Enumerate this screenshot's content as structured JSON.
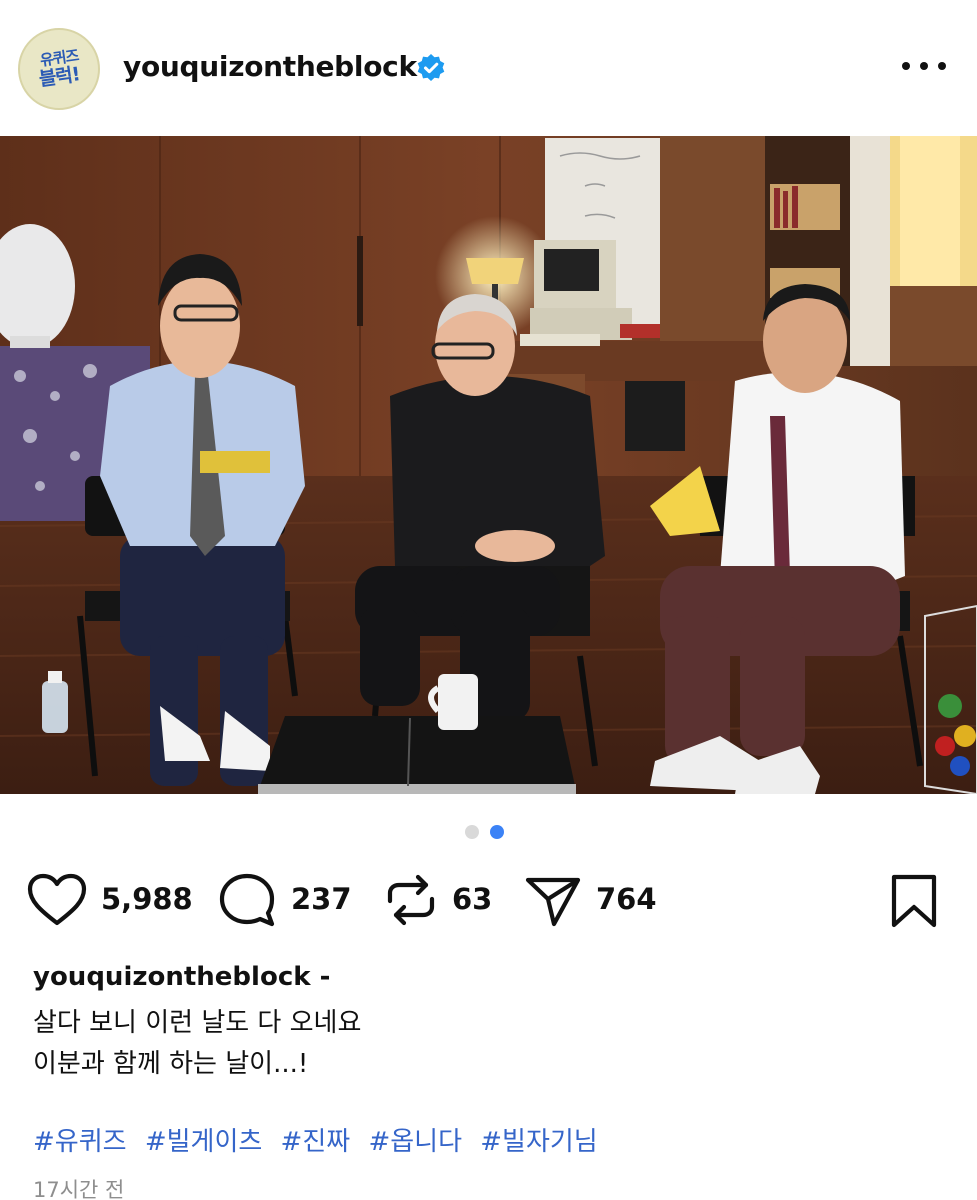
{
  "header": {
    "avatar_text_line1": "유퀴즈",
    "avatar_text_line2": "블럭!",
    "username": "youquizontheblock",
    "verified_icon": "verified-badge-icon",
    "more_icon": "more-horizontal-icon"
  },
  "carousel": {
    "total": 2,
    "active_index": 2
  },
  "actions": {
    "likes": "5,988",
    "comments": "237",
    "reposts": "63",
    "shares": "764"
  },
  "caption": {
    "username": "youquizontheblock",
    "separator": "-",
    "line1": "살다 보니 이런 날도 다 오네요",
    "line2": "이분과 함께 하는 날이...!",
    "hashtags": [
      "#유퀴즈",
      "#빌게이츠",
      "#진짜",
      "#옵니다",
      "#빌자기님"
    ]
  },
  "timestamp": "17시간 전",
  "colors": {
    "accent": "#3b82f6",
    "hashtag": "#3565c9",
    "muted": "#8e8e8e"
  }
}
